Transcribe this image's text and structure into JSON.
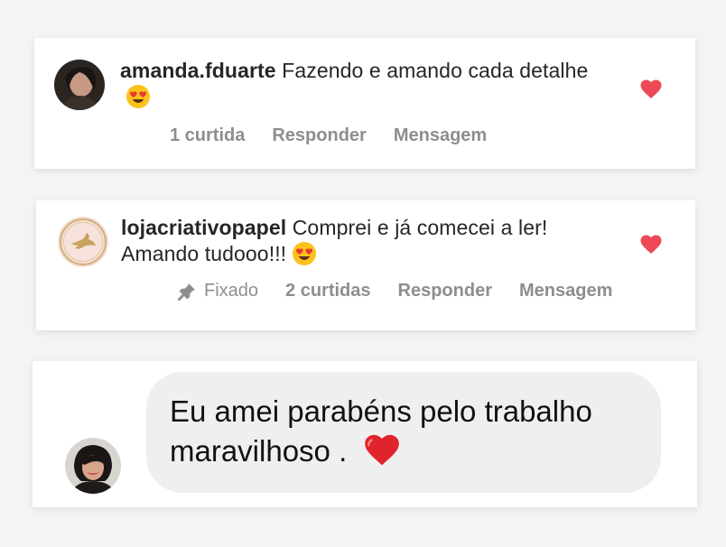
{
  "comments": [
    {
      "username": "amanda.fduarte",
      "text": "Fazendo e amando cada detalhe",
      "emoji": "heart-eyes-emoji",
      "actions": {
        "likes": "1 curtida",
        "reply": "Responder",
        "message": "Mensagem"
      },
      "liked": true
    },
    {
      "username": "lojacriativopapel",
      "text": "Comprei e já comecei a ler! Amando tudooo!!!",
      "emoji": "heart-eyes-emoji",
      "actions": {
        "pinned": "Fixado",
        "likes": "2 curtidas",
        "reply": "Responder",
        "message": "Mensagem"
      },
      "liked": true
    }
  ],
  "message_bubble": {
    "text": "Eu amei parabéns pelo trabalho maravilhoso .",
    "emoji": "red-heart-emoji"
  },
  "colors": {
    "like_red": "#ed4956",
    "muted_text": "#8e8e8e",
    "bubble_bg": "#efefef"
  }
}
